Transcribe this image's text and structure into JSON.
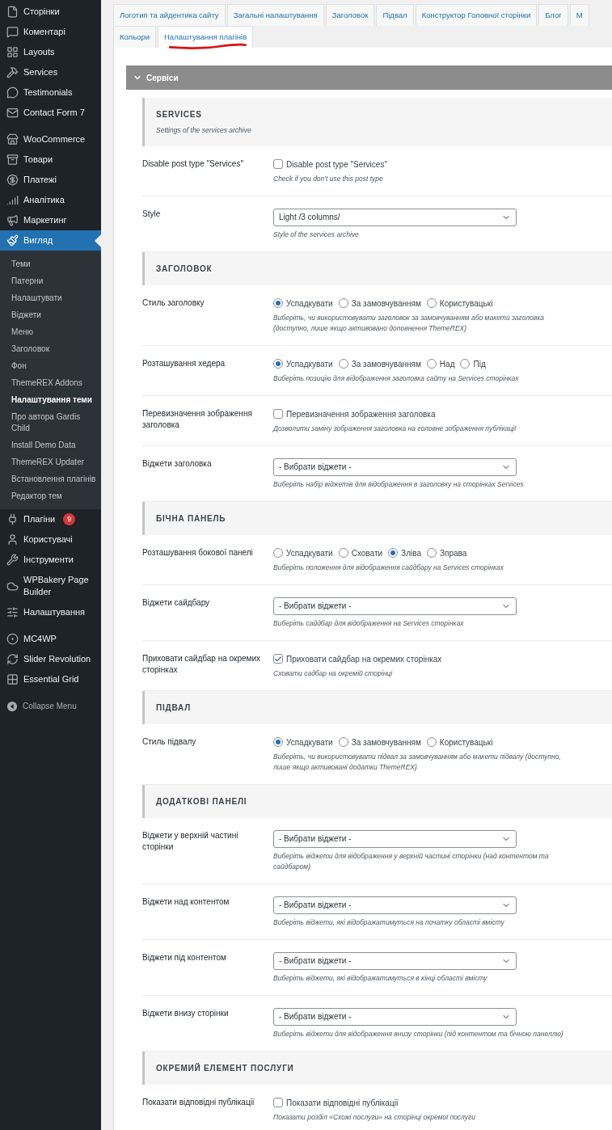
{
  "sidebar": {
    "groups": [
      [
        {
          "label": "Сторінки",
          "selected": false
        },
        {
          "label": "Коментарі",
          "selected": false
        },
        {
          "label": "Layouts",
          "selected": false
        },
        {
          "label": "Services",
          "selected": false
        },
        {
          "label": "Testimonials",
          "selected": false
        },
        {
          "label": "Contact Form 7",
          "selected": false
        }
      ],
      [
        {
          "label": "WooCommerce",
          "selected": false
        },
        {
          "label": "Товари",
          "selected": false
        },
        {
          "label": "Платежі",
          "selected": false
        },
        {
          "label": "Аналітика",
          "selected": false
        },
        {
          "label": "Маркетинг",
          "selected": false
        },
        {
          "label": "Вигляд",
          "selected": true,
          "children": [
            {
              "label": "Теми",
              "selected": false
            },
            {
              "label": "Патерни",
              "selected": false
            },
            {
              "label": "Налаштувати",
              "selected": false
            },
            {
              "label": "Віджети",
              "selected": false
            },
            {
              "label": "Меню",
              "selected": false
            },
            {
              "label": "Заголовок",
              "selected": false
            },
            {
              "label": "Фон",
              "selected": false
            },
            {
              "label": "ThemeREX Addons",
              "selected": false
            },
            {
              "label": "Налаштування теми",
              "selected": true
            },
            {
              "label": "Про автора Gardis Child",
              "selected": false
            },
            {
              "label": "Install Demo Data",
              "selected": false
            },
            {
              "label": "ThemeREX Updater",
              "selected": false
            },
            {
              "label": "Встановлення плагінів",
              "selected": false
            },
            {
              "label": "Редактор тем",
              "selected": false
            }
          ]
        },
        {
          "label": "Плагіни",
          "selected": false,
          "badge": "9"
        },
        {
          "label": "Користувачі",
          "selected": false
        },
        {
          "label": "Інструменти",
          "selected": false
        },
        {
          "label": "WPBakery Page Builder",
          "selected": false
        },
        {
          "label": "Налаштування",
          "selected": false
        }
      ],
      [
        {
          "label": "MC4WP",
          "selected": false
        },
        {
          "label": "Slider Revolution",
          "selected": false
        },
        {
          "label": "Essential Grid",
          "selected": false
        }
      ]
    ],
    "collapse": "Collapse Menu"
  },
  "tabs": [
    [
      {
        "label": "Логотип та айдентика сайту",
        "selected": false
      },
      {
        "label": "Загальні налаштування",
        "selected": false
      },
      {
        "label": "Заголовок",
        "selected": false
      },
      {
        "label": "Підвал",
        "selected": false
      },
      {
        "label": "Конструктор Головної сторінки",
        "selected": false
      },
      {
        "label": "Блог",
        "selected": false
      },
      {
        "label": "М",
        "selected": false
      }
    ],
    [
      {
        "label": "Кольори",
        "selected": false
      },
      {
        "label": "Налаштування плагінів",
        "selected": true
      }
    ]
  ],
  "panel": {
    "title": "Сервіси",
    "expanded": true,
    "sections": [
      {
        "title": "SERVICES",
        "subtitle": "Settings of the services archive",
        "fields": [
          {
            "label": "Disable post type \"Services\"",
            "kind": "checkbox",
            "text": "Disable post type \"Services\"",
            "checked": false,
            "hint": "Check if you don't use this post type"
          },
          {
            "label": "Style",
            "kind": "select",
            "value": "Light /3 columns/",
            "hint": "Style of the services archive"
          }
        ]
      },
      {
        "title": "ЗАГОЛОВОК",
        "fields": [
          {
            "label": "Стиль заголовку",
            "kind": "radio",
            "options": [
              {
                "label": "Успадкувати",
                "selected": true
              },
              {
                "label": "За замовчуванням",
                "selected": false
              },
              {
                "label": "Користувацькі",
                "selected": false
              }
            ],
            "hint": "Виберіть, чи використовувати заголовок за замовчуванням або макети заголовка (доступно, лише якщо активовано доповнення ThemeREX)"
          },
          {
            "label": "Розташування хедера",
            "kind": "radio",
            "options": [
              {
                "label": "Успадкувати",
                "selected": true
              },
              {
                "label": "За замовчуванням",
                "selected": false
              },
              {
                "label": "Над",
                "selected": false
              },
              {
                "label": "Під",
                "selected": false
              }
            ],
            "hint": "Виберіть позицію для відображення заголовка сайту на Services сторінках"
          },
          {
            "label": "Перевизначення зображення заголовка",
            "kind": "checkbox",
            "text": "Перевизначення зображення заголовка",
            "checked": false,
            "hint": "Дозволити заміну зображення заголовка на головне зображення публікації"
          },
          {
            "label": "Віджети заголовка",
            "kind": "select",
            "value": "- Вибрати віджети -",
            "hint": "Виберіть набір віджетів для відображення в заголовку на сторінках Services"
          }
        ]
      },
      {
        "title": "БІЧНА ПАНЕЛЬ",
        "fields": [
          {
            "label": "Розташування бокової панелі",
            "kind": "radio",
            "options": [
              {
                "label": "Успадкувати",
                "selected": false
              },
              {
                "label": "Сховати",
                "selected": false
              },
              {
                "label": "Зліва",
                "selected": true
              },
              {
                "label": "Зправа",
                "selected": false
              }
            ],
            "hint": "Виберіть положення для відображення сайдбару на Services сторінках"
          },
          {
            "label": "Віджети сайдбару",
            "kind": "select",
            "value": "- Вибрати віджети -",
            "hint": "Виберіть сайдбар для відображення на Services сторінках"
          },
          {
            "label": "Приховати сайдбар на окремих сторінках",
            "kind": "checkbox",
            "text": "Приховати сайдбар на окремих сторінках",
            "checked": true,
            "hint": "Сховати садбар на окремій сторінці"
          }
        ]
      },
      {
        "title": "ПІДВАЛ",
        "fields": [
          {
            "label": "Стиль підвалу",
            "kind": "radio",
            "options": [
              {
                "label": "Успадкувати",
                "selected": true
              },
              {
                "label": "За замовчуванням",
                "selected": false
              },
              {
                "label": "Користувацькі",
                "selected": false
              }
            ],
            "hint": "Виберіть, чи використовувати підвал за замовчуванням або макети підвалу (доступно, лише якщо активовані додатки ThemeREX)"
          }
        ]
      },
      {
        "title": "ДОДАТКОВІ ПАНЕЛІ",
        "fields": [
          {
            "label": "Віджети у верхній частині сторінки",
            "kind": "select",
            "value": "- Вибрати віджети -",
            "hint": "Виберіть віджети для відображення у верхній частині сторінки (над контентом та сайдбаром)"
          },
          {
            "label": "Віджети над контентом",
            "kind": "select",
            "value": "- Вибрати віджети -",
            "hint": "Виберіть віджети, які відображатимуться на початку області вмісту"
          },
          {
            "label": "Віджети під контентом",
            "kind": "select",
            "value": "- Вибрати віджети -",
            "hint": "Виберіть віджети, які відображатимуться в кінці області вмісту"
          },
          {
            "label": "Віджети внизу сторінки",
            "kind": "select",
            "value": "- Вибрати віджети -",
            "hint": "Виберіть віджети для відображення внизу сторінки (під контентом та бічною панеллю)"
          }
        ]
      },
      {
        "title": "ОКРЕМИЙ ЕЛЕМЕНТ ПОСЛУГИ",
        "fields": [
          {
            "label": "Показати відповідні публікації",
            "kind": "checkbox",
            "text": "Показати відповідні публікації",
            "checked": false,
            "hint": "Показати розділ «Схожі послуги» на сторінці окремої послуги"
          }
        ]
      }
    ]
  }
}
